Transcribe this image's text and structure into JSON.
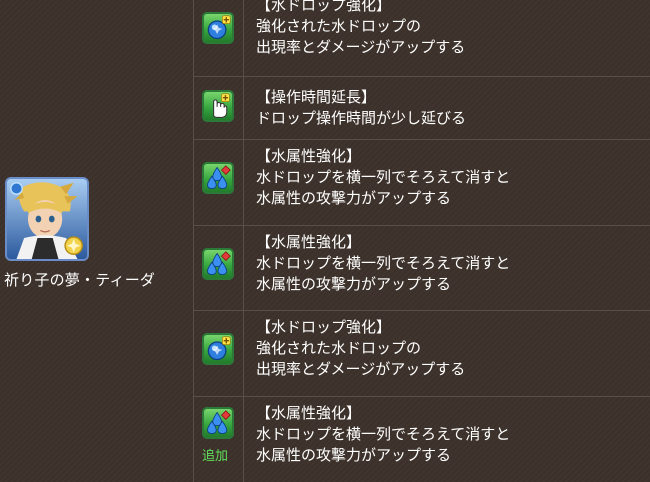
{
  "monster": {
    "name": "祈り子の夢・ティーダ"
  },
  "awakenings": [
    {
      "icon": "water-orb-enhance-icon",
      "title": "【水ドロップ強化】",
      "desc": [
        "強化された水ドロップの",
        "出現率とダメージがアップする"
      ],
      "added": ""
    },
    {
      "icon": "extend-time-icon",
      "title": "【操作時間延長】",
      "desc": [
        "ドロップ操作時間が少し延びる"
      ],
      "added": ""
    },
    {
      "icon": "water-row-enhance-icon",
      "title": "【水属性強化】",
      "desc": [
        "水ドロップを横一列でそろえて消すと",
        "水属性の攻撃力がアップする"
      ],
      "added": ""
    },
    {
      "icon": "water-row-enhance-icon",
      "title": "【水属性強化】",
      "desc": [
        "水ドロップを横一列でそろえて消すと",
        "水属性の攻撃力がアップする"
      ],
      "added": ""
    },
    {
      "icon": "water-orb-enhance-icon",
      "title": "【水ドロップ強化】",
      "desc": [
        "強化された水ドロップの",
        "出現率とダメージがアップする"
      ],
      "added": ""
    },
    {
      "icon": "water-row-enhance-icon",
      "title": "【水属性強化】",
      "desc": [
        "水ドロップを横一列でそろえて消すと",
        "水属性の攻撃力がアップする"
      ],
      "added": "追加"
    }
  ],
  "colors": {
    "background": "#3d322b",
    "divider": "#5a4e45",
    "text": "#ffffff",
    "added": "#5fe05a",
    "icon_green": "#38a640"
  }
}
